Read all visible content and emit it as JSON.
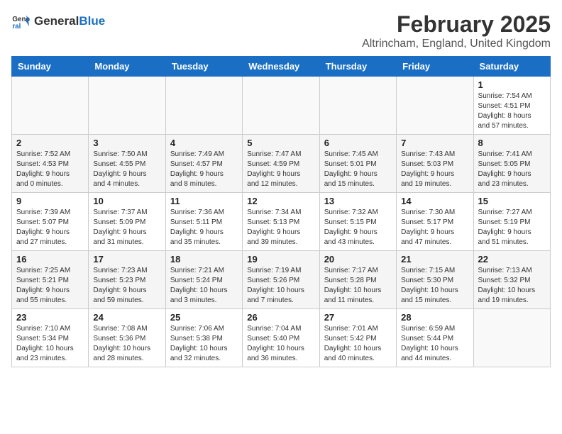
{
  "logo": {
    "general": "General",
    "blue": "Blue"
  },
  "header": {
    "month": "February 2025",
    "location": "Altrincham, England, United Kingdom"
  },
  "days_of_week": [
    "Sunday",
    "Monday",
    "Tuesday",
    "Wednesday",
    "Thursday",
    "Friday",
    "Saturday"
  ],
  "weeks": [
    [
      {
        "day": "",
        "info": ""
      },
      {
        "day": "",
        "info": ""
      },
      {
        "day": "",
        "info": ""
      },
      {
        "day": "",
        "info": ""
      },
      {
        "day": "",
        "info": ""
      },
      {
        "day": "",
        "info": ""
      },
      {
        "day": "1",
        "info": "Sunrise: 7:54 AM\nSunset: 4:51 PM\nDaylight: 8 hours\nand 57 minutes."
      }
    ],
    [
      {
        "day": "2",
        "info": "Sunrise: 7:52 AM\nSunset: 4:53 PM\nDaylight: 9 hours\nand 0 minutes."
      },
      {
        "day": "3",
        "info": "Sunrise: 7:50 AM\nSunset: 4:55 PM\nDaylight: 9 hours\nand 4 minutes."
      },
      {
        "day": "4",
        "info": "Sunrise: 7:49 AM\nSunset: 4:57 PM\nDaylight: 9 hours\nand 8 minutes."
      },
      {
        "day": "5",
        "info": "Sunrise: 7:47 AM\nSunset: 4:59 PM\nDaylight: 9 hours\nand 12 minutes."
      },
      {
        "day": "6",
        "info": "Sunrise: 7:45 AM\nSunset: 5:01 PM\nDaylight: 9 hours\nand 15 minutes."
      },
      {
        "day": "7",
        "info": "Sunrise: 7:43 AM\nSunset: 5:03 PM\nDaylight: 9 hours\nand 19 minutes."
      },
      {
        "day": "8",
        "info": "Sunrise: 7:41 AM\nSunset: 5:05 PM\nDaylight: 9 hours\nand 23 minutes."
      }
    ],
    [
      {
        "day": "9",
        "info": "Sunrise: 7:39 AM\nSunset: 5:07 PM\nDaylight: 9 hours\nand 27 minutes."
      },
      {
        "day": "10",
        "info": "Sunrise: 7:37 AM\nSunset: 5:09 PM\nDaylight: 9 hours\nand 31 minutes."
      },
      {
        "day": "11",
        "info": "Sunrise: 7:36 AM\nSunset: 5:11 PM\nDaylight: 9 hours\nand 35 minutes."
      },
      {
        "day": "12",
        "info": "Sunrise: 7:34 AM\nSunset: 5:13 PM\nDaylight: 9 hours\nand 39 minutes."
      },
      {
        "day": "13",
        "info": "Sunrise: 7:32 AM\nSunset: 5:15 PM\nDaylight: 9 hours\nand 43 minutes."
      },
      {
        "day": "14",
        "info": "Sunrise: 7:30 AM\nSunset: 5:17 PM\nDaylight: 9 hours\nand 47 minutes."
      },
      {
        "day": "15",
        "info": "Sunrise: 7:27 AM\nSunset: 5:19 PM\nDaylight: 9 hours\nand 51 minutes."
      }
    ],
    [
      {
        "day": "16",
        "info": "Sunrise: 7:25 AM\nSunset: 5:21 PM\nDaylight: 9 hours\nand 55 minutes."
      },
      {
        "day": "17",
        "info": "Sunrise: 7:23 AM\nSunset: 5:23 PM\nDaylight: 9 hours\nand 59 minutes."
      },
      {
        "day": "18",
        "info": "Sunrise: 7:21 AM\nSunset: 5:24 PM\nDaylight: 10 hours\nand 3 minutes."
      },
      {
        "day": "19",
        "info": "Sunrise: 7:19 AM\nSunset: 5:26 PM\nDaylight: 10 hours\nand 7 minutes."
      },
      {
        "day": "20",
        "info": "Sunrise: 7:17 AM\nSunset: 5:28 PM\nDaylight: 10 hours\nand 11 minutes."
      },
      {
        "day": "21",
        "info": "Sunrise: 7:15 AM\nSunset: 5:30 PM\nDaylight: 10 hours\nand 15 minutes."
      },
      {
        "day": "22",
        "info": "Sunrise: 7:13 AM\nSunset: 5:32 PM\nDaylight: 10 hours\nand 19 minutes."
      }
    ],
    [
      {
        "day": "23",
        "info": "Sunrise: 7:10 AM\nSunset: 5:34 PM\nDaylight: 10 hours\nand 23 minutes."
      },
      {
        "day": "24",
        "info": "Sunrise: 7:08 AM\nSunset: 5:36 PM\nDaylight: 10 hours\nand 28 minutes."
      },
      {
        "day": "25",
        "info": "Sunrise: 7:06 AM\nSunset: 5:38 PM\nDaylight: 10 hours\nand 32 minutes."
      },
      {
        "day": "26",
        "info": "Sunrise: 7:04 AM\nSunset: 5:40 PM\nDaylight: 10 hours\nand 36 minutes."
      },
      {
        "day": "27",
        "info": "Sunrise: 7:01 AM\nSunset: 5:42 PM\nDaylight: 10 hours\nand 40 minutes."
      },
      {
        "day": "28",
        "info": "Sunrise: 6:59 AM\nSunset: 5:44 PM\nDaylight: 10 hours\nand 44 minutes."
      },
      {
        "day": "",
        "info": ""
      }
    ]
  ]
}
